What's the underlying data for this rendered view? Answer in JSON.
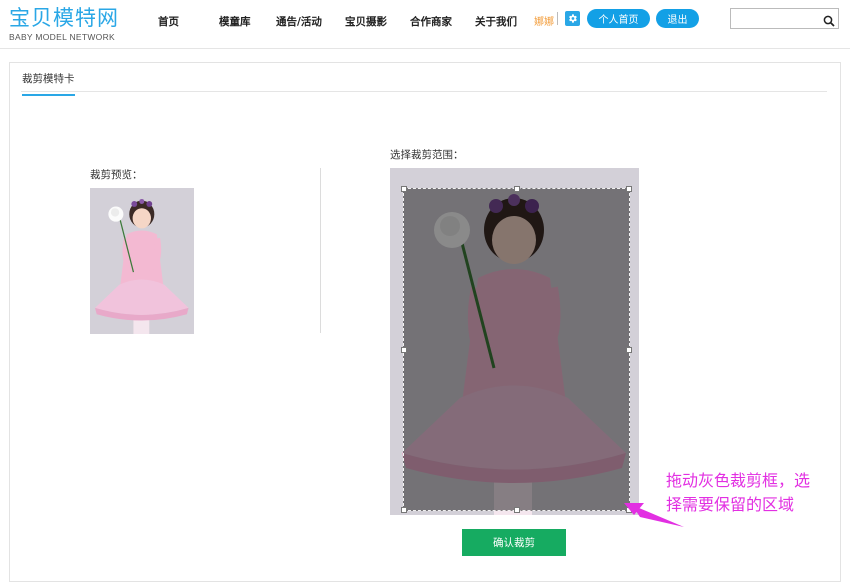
{
  "brand": {
    "name_cn": "宝贝模特网",
    "name_en": "BABY MODEL NETWORK",
    "color": "#2aa7e6"
  },
  "nav": {
    "items": [
      {
        "label": "首页"
      },
      {
        "label": "模童库"
      },
      {
        "label": "通告/活动"
      },
      {
        "label": "宝贝摄影"
      },
      {
        "label": "合作商家"
      },
      {
        "label": "关于我们"
      }
    ]
  },
  "user": {
    "name": "娜娜",
    "settings_icon": "gear-icon",
    "home_button": "个人首页",
    "logout_button": "退出"
  },
  "search": {
    "value": "",
    "placeholder": "",
    "icon": "search-icon"
  },
  "tabs": [
    {
      "label": "裁剪模特卡",
      "active": true
    }
  ],
  "preview": {
    "label": "裁剪预览："
  },
  "crop": {
    "label": "选择裁剪范围：",
    "confirm_button": "确认裁剪"
  },
  "hint": {
    "line1": "拖动灰色裁剪框，选",
    "line2": "择需要保留的区域",
    "color": "#e22fe2"
  },
  "colors": {
    "accent": "#13a0e6",
    "confirm": "#16ab61",
    "username": "#f29b38"
  }
}
